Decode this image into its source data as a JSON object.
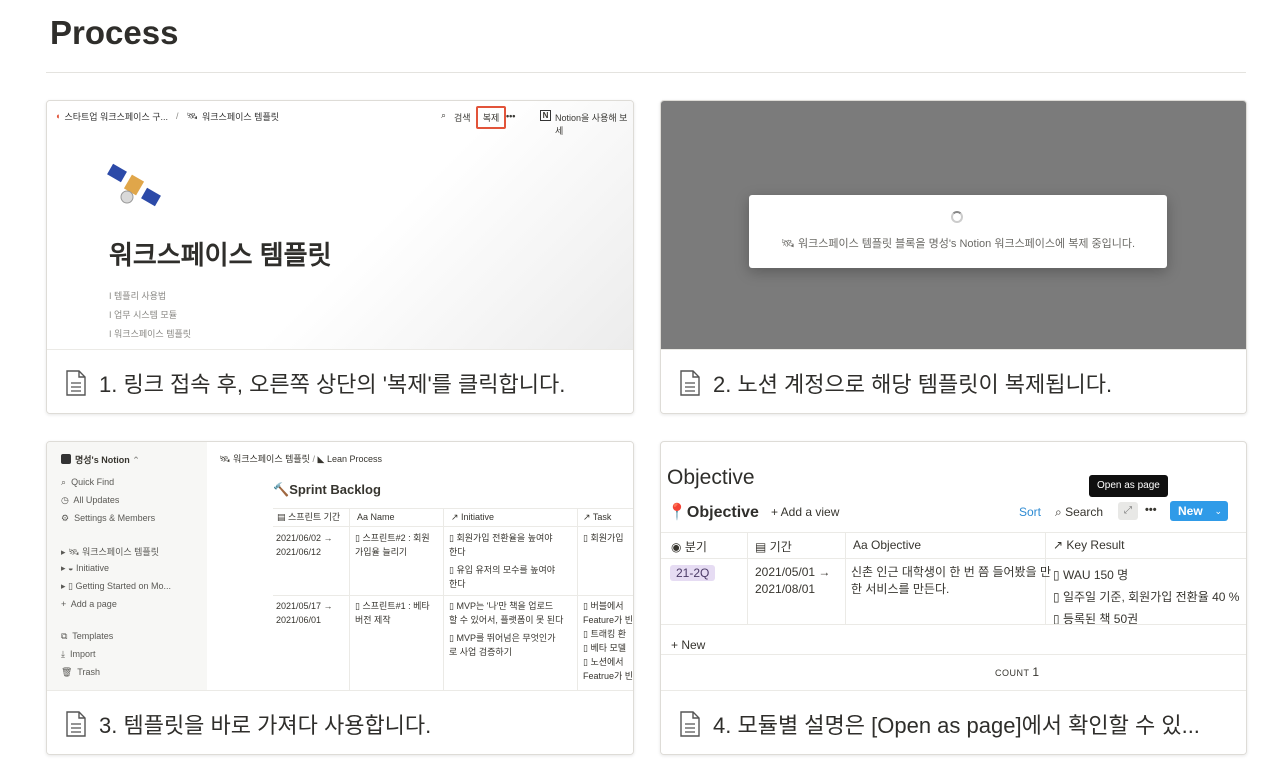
{
  "page": {
    "title": "Process"
  },
  "cards": [
    {
      "caption": "1. 링크 접속 후, 오른쪽 상단의 '복제'를 클릭합니다."
    },
    {
      "caption": "2. 노션 계정으로 해당 템플릿이 복제됩니다."
    },
    {
      "caption": "3. 템플릿을 바로 가져다 사용합니다."
    },
    {
      "caption": "4. 모듈별 설명은 [Open as page]에서 확인할 수 있..."
    }
  ],
  "shot1": {
    "breadcrumb1": "스타트업 워크스페이스 구...",
    "sep": "/",
    "breadcrumb2": "워크스페이스 템플릿",
    "search": "검색",
    "duplicate": "복제",
    "more": "•••",
    "notion": "Notion을 사용해 보세",
    "title": "워크스페이스 템플릿",
    "items": [
      "템플리 사용법",
      "업무 시스템 모듈",
      "워크스페이스 템플릿"
    ]
  },
  "shot2": {
    "message": "워크스페이스 템플릿 블록을 명성's Notion 워크스페이스에 복제 중입니다."
  },
  "shot3": {
    "workspace": "명성's Notion",
    "nav": [
      "Quick Find",
      "All Updates",
      "Settings & Members"
    ],
    "pages": [
      "워크스페이스 템플릿",
      "Initiative",
      "Getting Started on Mo...",
      "Add a page"
    ],
    "bottom": [
      "Templates",
      "Import",
      "Trash"
    ],
    "crumb1": "워크스페이스 템플릿",
    "crumb_sep": "/",
    "crumb2": "Lean Process",
    "db_title": "Sprint Backlog",
    "headers": [
      "스프린트 기간",
      "Name",
      "Initiative",
      "Task"
    ],
    "rows": [
      {
        "period1": "2021/06/02 →",
        "period2": "2021/06/12",
        "name1": "스프린트#2 : 회원",
        "name2": "가입율 늘리기",
        "init": [
          "회원가입 전환율을 높여야",
          "한다",
          "유입 유저의 모수를 높여야",
          "한다"
        ],
        "task": [
          "회원가입"
        ]
      },
      {
        "period1": "2021/05/17 →",
        "period2": "2021/06/01",
        "name1": "스프린트#1 : 베타",
        "name2": "버전 제작",
        "init": [
          "MVP는 '나'만 책을 업로드",
          "할 수 있어서, 플랫폼이 못 된다",
          "MVP를 뛰어넘은 무엇인가",
          "로 사업 검증하기"
        ],
        "task": [
          "버블에서",
          "Feature가 빈",
          "트래킹 환",
          "베타 모델",
          "노션에서",
          "Featrue가 빈"
        ]
      }
    ]
  },
  "shot4": {
    "page_title": "Objective",
    "tooltip": "Open as page",
    "db_title": "Objective",
    "add_view": "+ Add a view",
    "sort": "Sort",
    "search": "Search",
    "more": "•••",
    "new_btn": "New",
    "headers": [
      "분기",
      "기간",
      "Objective",
      "Key Result"
    ],
    "row": {
      "quarter": "21-2Q",
      "period1": "2021/05/01 →",
      "period2": "2021/08/01",
      "objective1": "신촌 인근 대학생이 한 번 쯤 들어봤을 만",
      "objective2": "한 서비스를 만든다.",
      "key_results": [
        "WAU 150 명",
        "일주일 기준, 회원가입 전환율 40 %",
        "등록된 책 50권"
      ]
    },
    "new_row": "+ New",
    "count_label": "COUNT",
    "count_value": "1"
  }
}
